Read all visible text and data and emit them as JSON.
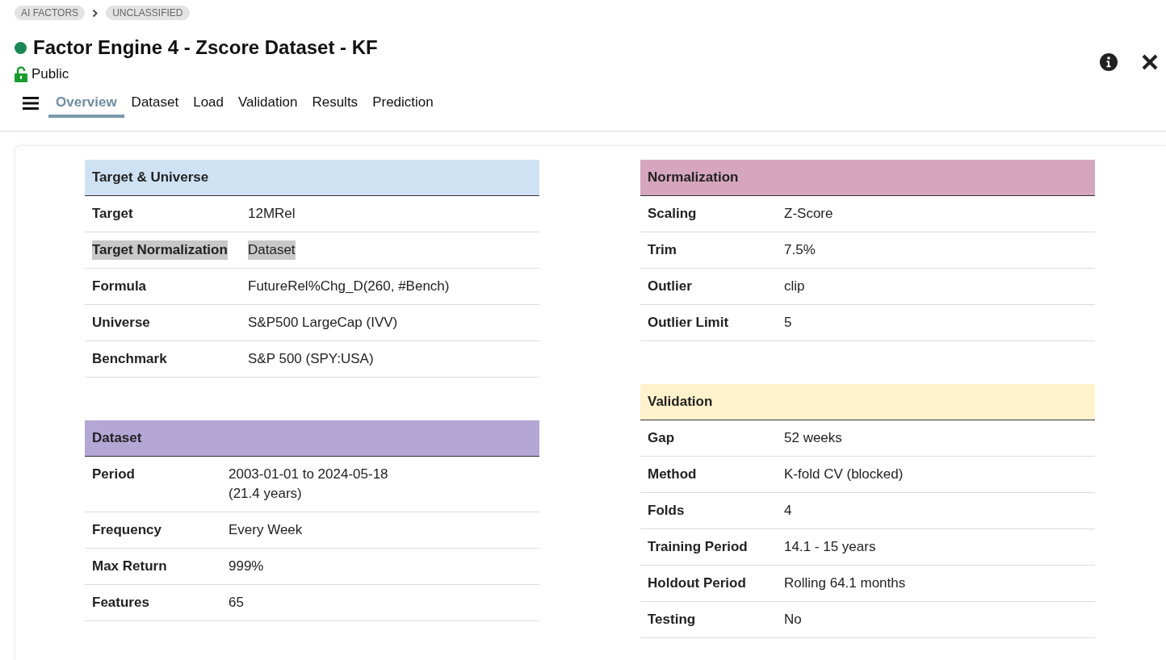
{
  "breadcrumbs": [
    "AI FACTORS",
    "UNCLASSIFIED"
  ],
  "title": "Factor Engine 4 - Zscore Dataset - KF",
  "active": true,
  "visibility": "Public",
  "tabs": [
    {
      "label": "Overview",
      "selected": true
    },
    {
      "label": "Dataset",
      "selected": false
    },
    {
      "label": "Load",
      "selected": false
    },
    {
      "label": "Validation",
      "selected": false
    },
    {
      "label": "Results",
      "selected": false
    },
    {
      "label": "Prediction",
      "selected": false
    }
  ],
  "columns": [
    {
      "sections": [
        {
          "title": "Target & Universe",
          "color": "#cfe2f3",
          "rows": [
            {
              "label": "Target",
              "value": [
                "12MRel"
              ],
              "highlighted": false
            },
            {
              "label": "Target Normalization",
              "value": [
                "Dataset"
              ],
              "highlighted": true
            },
            {
              "label": "Formula",
              "value": [
                "FutureRel%Chg_D(260, #Bench)"
              ],
              "highlighted": false
            },
            {
              "label": "Universe",
              "value": [
                "S&P500 LargeCap (IVV)"
              ],
              "highlighted": false
            },
            {
              "label": "Benchmark",
              "value": [
                "S&P 500 (SPY:USA)"
              ],
              "highlighted": false
            }
          ]
        },
        {
          "title": "Dataset",
          "color": "#b4a7d6",
          "rows": [
            {
              "label": "Period",
              "value": [
                "2003-01-01 to 2024-05-18",
                "(21.4 years)"
              ],
              "highlighted": false
            },
            {
              "label": "Frequency",
              "value": [
                "Every Week"
              ],
              "highlighted": false
            },
            {
              "label": "Max Return",
              "value": [
                "999%"
              ],
              "highlighted": false
            },
            {
              "label": "Features",
              "value": [
                "65"
              ],
              "highlighted": false
            }
          ]
        }
      ]
    },
    {
      "sections": [
        {
          "title": "Normalization",
          "color": "#d5a6bd",
          "rows": [
            {
              "label": "Scaling",
              "value": [
                "Z-Score"
              ],
              "highlighted": false
            },
            {
              "label": "Trim",
              "value": [
                "7.5%"
              ],
              "highlighted": false
            },
            {
              "label": "Outlier",
              "value": [
                "clip"
              ],
              "highlighted": false
            },
            {
              "label": "Outlier Limit",
              "value": [
                "5"
              ],
              "highlighted": false
            }
          ]
        },
        {
          "title": "Validation",
          "color": "#fff2cc",
          "rows": [
            {
              "label": "Gap",
              "value": [
                "52 weeks"
              ],
              "highlighted": false
            },
            {
              "label": "Method",
              "value": [
                "K-fold CV (blocked)"
              ],
              "highlighted": false
            },
            {
              "label": "Folds",
              "value": [
                "4"
              ],
              "highlighted": false
            },
            {
              "label": "Training Period",
              "value": [
                "14.1 - 15 years"
              ],
              "highlighted": false
            },
            {
              "label": "Holdout Period",
              "value": [
                "Rolling 64.1 months"
              ],
              "highlighted": false
            },
            {
              "label": "Testing",
              "value": [
                "No"
              ],
              "highlighted": false
            }
          ]
        }
      ]
    }
  ]
}
